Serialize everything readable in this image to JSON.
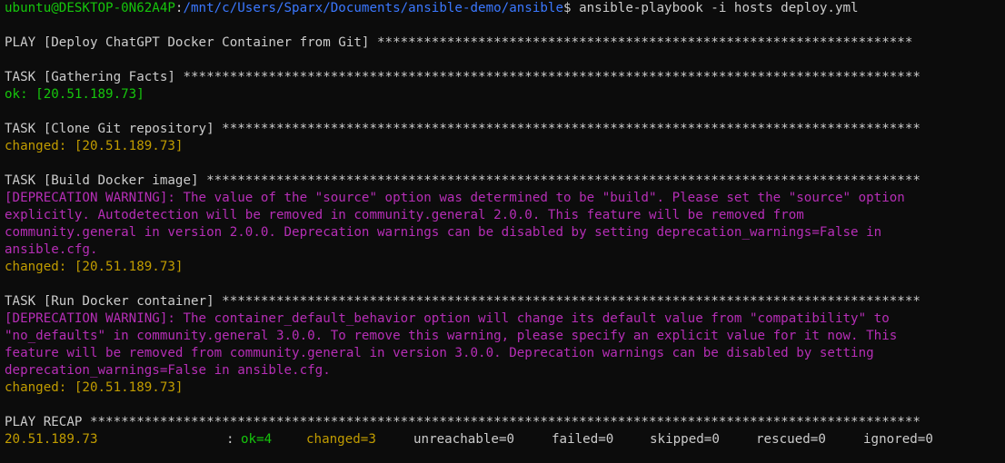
{
  "prompt": {
    "userhost": "ubuntu@DESKTOP-0N62A4P",
    "sep": ":",
    "path": "/mnt/c/Users/Sparx/Documents/ansible-demo/ansible",
    "dollar": "$",
    "command": " ansible-playbook -i hosts deploy.yml"
  },
  "play_header": "PLAY [Deploy ChatGPT Docker Container from Git] *********************************************************************",
  "tasks": [
    {
      "header": "TASK [Gathering Facts] ***********************************************************************************************",
      "result": "ok: [20.51.189.73]"
    },
    {
      "header": "TASK [Clone Git repository] ******************************************************************************************",
      "result": "changed: [20.51.189.73]"
    },
    {
      "header": "TASK [Build Docker image] ********************************************************************************************",
      "warning": [
        "[DEPRECATION WARNING]: The value of the \"source\" option was determined to be \"build\". Please set the \"source\" option",
        "explicitly. Autodetection will be removed in community.general 2.0.0. This feature will be removed from",
        "community.general in version 2.0.0. Deprecation warnings can be disabled by setting deprecation_warnings=False in",
        "ansible.cfg."
      ],
      "result": "changed: [20.51.189.73]"
    },
    {
      "header": "TASK [Run Docker container] ******************************************************************************************",
      "warning": [
        "[DEPRECATION WARNING]: The container_default_behavior option will change its default value from \"compatibility\" to",
        "\"no_defaults\" in community.general 3.0.0. To remove this warning, please specify an explicit value for it now. This",
        "feature will be removed from community.general in version 3.0.0. Deprecation warnings can be disabled by setting",
        "deprecation_warnings=False in ansible.cfg."
      ],
      "result": "changed: [20.51.189.73]"
    }
  ],
  "recap": {
    "header": "PLAY RECAP ***********************************************************************************************************",
    "host": "20.51.189.73",
    "colon": ":",
    "ok": "ok=4",
    "changed": "changed=3",
    "unreachable": "unreachable=0",
    "failed": "failed=0",
    "skipped": "skipped=0",
    "rescued": "rescued=0",
    "ignored": "ignored=0"
  },
  "colors": {
    "background": "#0c0c0c",
    "text": "#cccccc",
    "green": "#16c60c",
    "blue": "#3b78ff",
    "yellow": "#c19c00",
    "magenta": "#b62eb6"
  }
}
